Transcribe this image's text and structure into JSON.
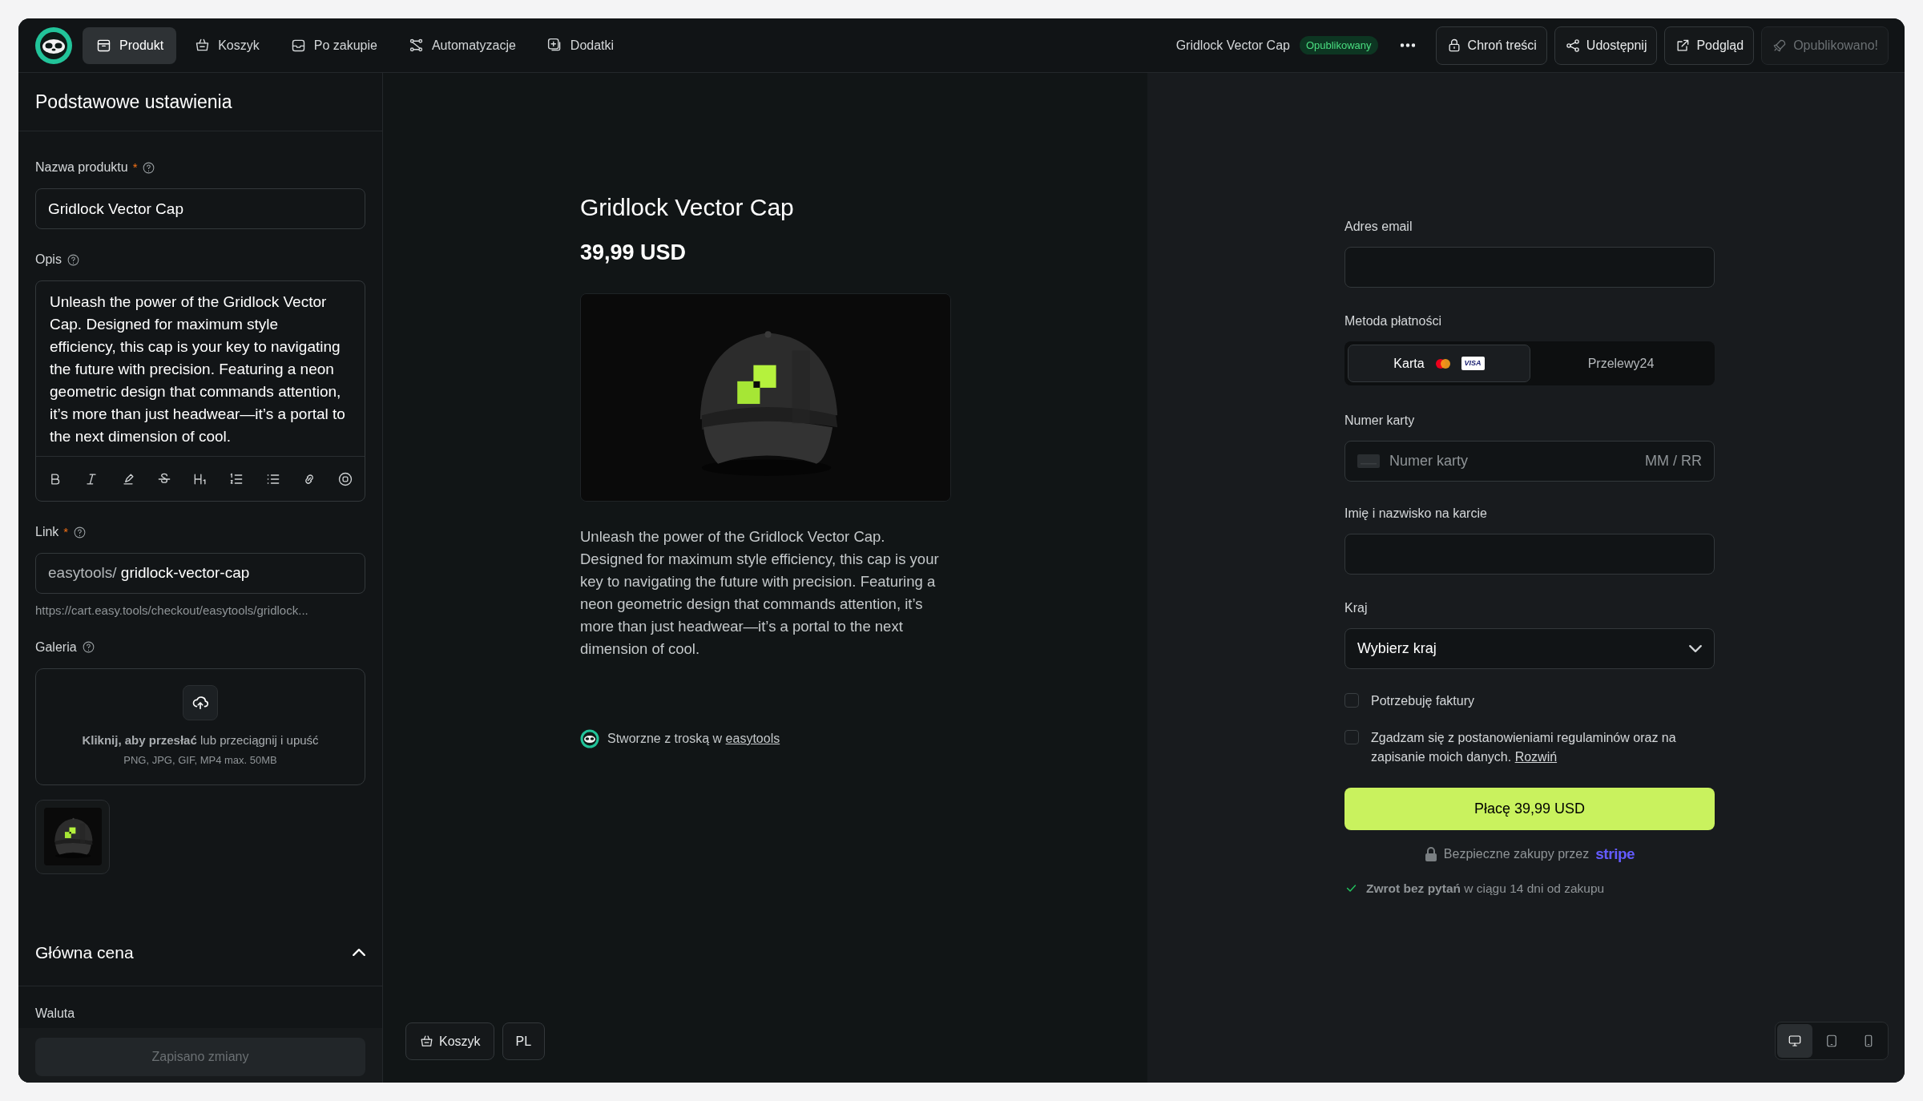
{
  "topbar": {
    "nav": [
      {
        "label": "Produkt",
        "kind": "box",
        "selected": true
      },
      {
        "label": "Koszyk",
        "kind": "basket",
        "selected": false
      },
      {
        "label": "Po zakupie",
        "kind": "inbox",
        "selected": false
      },
      {
        "label": "Automatyzacje",
        "kind": "flow",
        "selected": false
      },
      {
        "label": "Dodatki",
        "kind": "addon",
        "selected": false
      }
    ],
    "product_name": "Gridlock Vector Cap",
    "status_badge": "Opublikowany",
    "actions": [
      {
        "label": "Chroń treści",
        "kind": "lock",
        "disabled": false
      },
      {
        "label": "Udostępnij",
        "kind": "share",
        "disabled": false
      },
      {
        "label": "Podgląd",
        "kind": "external",
        "disabled": false
      },
      {
        "label": "Opublikowano!",
        "kind": "rocket",
        "disabled": true
      }
    ]
  },
  "settings": {
    "title": "Podstawowe ustawienia",
    "name_field": {
      "label": "Nazwa produktu",
      "required_mark": "*",
      "value": "Gridlock Vector Cap"
    },
    "description_field": {
      "label": "Opis",
      "value": "Unleash the power of the Gridlock Vector Cap. Designed for maximum style efficiency, this cap is your key to navigating the future with precision. Featuring a neon geometric design that commands attention, it’s more than just headwear—it’s a portal to the next dimension of cool.",
      "toolbar": [
        {
          "kind": "bold"
        },
        {
          "kind": "italic"
        },
        {
          "kind": "highlight"
        },
        {
          "kind": "strike"
        },
        {
          "kind": "heading"
        },
        {
          "kind": "ordered"
        },
        {
          "kind": "bullets"
        },
        {
          "kind": "link"
        },
        {
          "kind": "emoji"
        }
      ]
    },
    "link_field": {
      "label": "Link",
      "required_mark": "*",
      "prefix": "easytools/",
      "value": "gridlock-vector-cap",
      "url": "https://cart.easy.tools/checkout/easytools/gridlock..."
    },
    "gallery": {
      "label": "Galeria",
      "upload_text": "**Kliknij, aby przesłać** lub przeciągnij i upuść",
      "upload_hint": "PNG, JPG, GIF, MP4 max. 50MB"
    },
    "price_section": {
      "title": "Główna cena",
      "expanded": true
    },
    "currency_label": "Waluta",
    "save_button": {
      "label": "Zapisano zmiany",
      "disabled": true
    }
  },
  "preview": {
    "title": "Gridlock Vector Cap",
    "price": "39,99 USD",
    "description": "Unleash the power of the Gridlock Vector Cap. Designed for maximum style efficiency, this cap is your key to navigating the future with precision. Featuring a neon geometric design that commands attention, it’s more than just headwear—it’s a portal to the next dimension of cool.",
    "credit_text": "Stworzne z troską w ",
    "credit_link": "easytools",
    "bottom_buttons": [
      {
        "label": "Koszyk",
        "kind": "basket"
      },
      {
        "label": "PL",
        "kind": "text"
      }
    ]
  },
  "checkout": {
    "email_label": "Adres email",
    "payment_label": "Metoda płatności",
    "payment_methods": [
      {
        "label": "Karta",
        "kind": "card",
        "badge": "VISA",
        "selected": true
      },
      {
        "label": "Przelewy24",
        "kind": "plain",
        "selected": false
      }
    ],
    "card_label": "Numer karty",
    "card_placeholder": "Numer karty",
    "expiry_placeholder": "MM / RR",
    "name_label": "Imię i nazwisko na karcie",
    "country_label": "Kraj",
    "country_value": "Wybierz kraj",
    "checkboxes": [
      {
        "label": "Potrzebuję faktury",
        "checked": false
      },
      {
        "label": "Zgadzam się z postanowieniami regulaminów oraz na zapisanie moich danych. ",
        "link": "Rozwiń",
        "checked": false
      }
    ],
    "pay_button": "Płacę 39,99 USD",
    "secure_text": "Bezpieczne zakupy przez",
    "secure_brand": "stripe",
    "refund_text": "**Zwrot bez pytań** w ciągu 14 dni od zakupu"
  },
  "device_toggle": [
    {
      "kind": "desktop",
      "selected": true
    },
    {
      "kind": "tablet",
      "selected": false
    },
    {
      "kind": "phone",
      "selected": false
    }
  ]
}
